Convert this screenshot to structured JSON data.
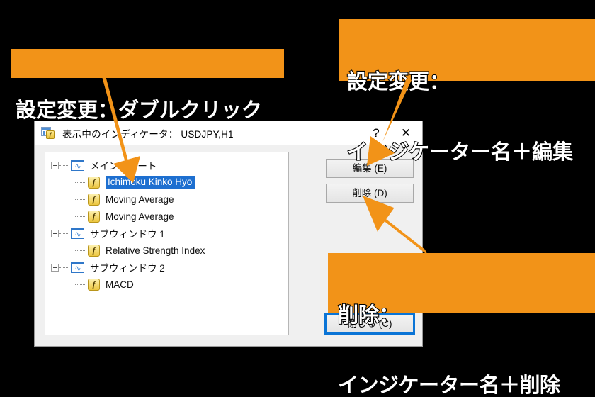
{
  "dialog": {
    "title": "表示中のインディケータ： USDJPY,H1",
    "icon": "window-function-icon",
    "help_label": "?",
    "close_label": "✕",
    "tree": [
      {
        "label": "メインチャート",
        "icon": "chart-window-icon",
        "expander": "minus",
        "children": [
          {
            "label": "Ichimoku Kinko Hyo",
            "icon": "function-icon",
            "selected": true
          },
          {
            "label": "Moving Average",
            "icon": "function-icon",
            "selected": false
          },
          {
            "label": "Moving Average",
            "icon": "function-icon",
            "selected": false
          }
        ]
      },
      {
        "label": "サブウィンドウ 1",
        "icon": "chart-window-icon",
        "expander": "minus",
        "children": [
          {
            "label": "Relative Strength Index",
            "icon": "function-icon",
            "selected": false
          }
        ]
      },
      {
        "label": "サブウィンドウ 2",
        "icon": "chart-window-icon",
        "expander": "minus",
        "children": [
          {
            "label": "MACD",
            "icon": "function-icon",
            "selected": false
          }
        ]
      }
    ],
    "buttons": {
      "edit": "編集 (E)",
      "delete": "削除 (D)",
      "close": "閉じる (C)"
    }
  },
  "annotations": [
    {
      "id": "double-click-note",
      "line1": "設定変更：ダブルクリック",
      "line2": ""
    },
    {
      "id": "edit-note",
      "line1": "設定変更：",
      "line2": "インジケーター名＋編集"
    },
    {
      "id": "delete-note",
      "line1": "削除：",
      "line2": "インジケーター名＋削除"
    }
  ],
  "colors": {
    "annotation_bg": "#f29318",
    "annotation_text": "#ffffff",
    "annotation_outline": "#000000",
    "backdrop": "#000000",
    "selection_blue": "#1d6fd0",
    "focus_blue": "#0a74d6"
  }
}
